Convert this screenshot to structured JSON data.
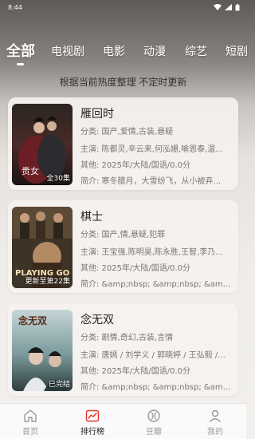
{
  "status_bar": {
    "time": "8:44"
  },
  "tabs": [
    "全部",
    "电视剧",
    "电影",
    "动漫",
    "综艺",
    "短剧"
  ],
  "subtitle": "根据当前热度整理 不定时更新",
  "cards": [
    {
      "title": "雁回时",
      "category": "分类: 国产,爱情,古装,悬疑",
      "cast": "主演: 陈都灵,辛云来,何泓姗,喻恩泰,温...",
      "other": "其他: 2025年/大陆/国语/0.0分",
      "intro": "简介: 寒冬腊月，大雪纷飞，从小被弃...",
      "badge": "全30集",
      "poster_text": "贵女"
    },
    {
      "title": "棋士",
      "category": "分类: 国产,情,悬疑,犯罪",
      "cast": "主演: 王宝强,陈明昊,陈永胜,王智,李乃...",
      "other": "其他: 2025年/大陆/国语/0.0分",
      "intro": "简介: &amp;nbsp; &amp;nbsp; &amp;nb...",
      "badge": "更新至第22集",
      "poster_text": "PLAYING GO"
    },
    {
      "title": "念无双",
      "category": "分类: 剧情,奇幻,古装,言情",
      "cast": "主演: 唐嫣 / 刘学义 / 郭晓婷 / 王弘毅 /...",
      "other": "其他: 2025年/大陆/国语/0.0分",
      "intro": "简介: &amp;nbsp; &amp;nbsp; &amp;nb...",
      "badge": "已完结",
      "poster_text": "念无双"
    }
  ],
  "bottom_nav": [
    {
      "label": "首页",
      "icon": "home-icon",
      "active": false
    },
    {
      "label": "排行榜",
      "icon": "chart-icon",
      "active": true
    },
    {
      "label": "豆瓣",
      "icon": "douban-icon",
      "active": false
    },
    {
      "label": "我的",
      "icon": "user-icon",
      "active": false
    }
  ],
  "colors": {
    "accent": "#e0352b"
  }
}
